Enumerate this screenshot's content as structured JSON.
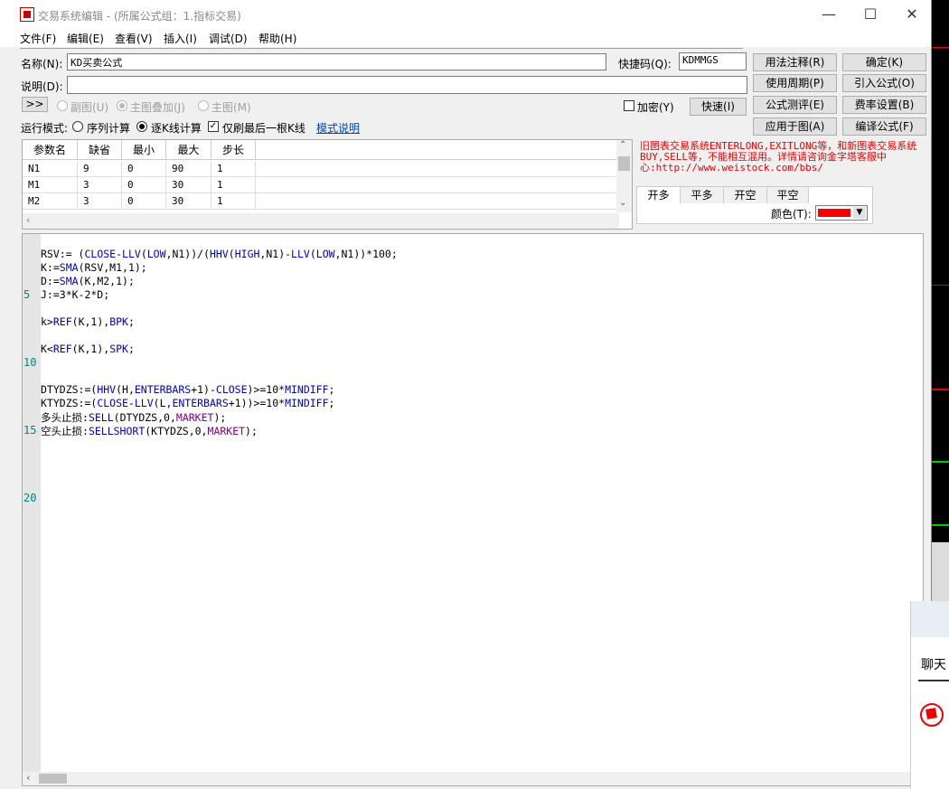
{
  "window": {
    "title": "交易系统编辑 - (所属公式组：1.指标交易)",
    "controls": {
      "minimize": "—",
      "maximize": "☐",
      "close": "✕"
    }
  },
  "menu": [
    "文件(F)",
    "编辑(E)",
    "查看(V)",
    "插入(I)",
    "调试(D)",
    "帮助(H)"
  ],
  "form": {
    "name_label": "名称(N):",
    "name_value": "KD买卖公式",
    "shortcut_label": "快捷码(Q):",
    "shortcut_value": "KDMMGS",
    "desc_label": "说明(D):",
    "desc_value": "",
    "expand_btn": ">>",
    "sub_chart": "副图(U)",
    "main_overlay": "主图叠加(J)",
    "main_chart": "主图(M)",
    "encrypt": "加密(Y)",
    "quick_btn": "快速(I)",
    "run_mode_label": "运行模式:",
    "seq_calc": "序列计算",
    "kline_calc": "逐K线计算",
    "refresh_last": "仅刷最后一根K线",
    "mode_link": "模式说明"
  },
  "buttons": {
    "usage": "用法注释(R)",
    "confirm": "确定(K)",
    "use_period": "使用周期(P)",
    "import": "引入公式(O)",
    "test": "公式测评(E)",
    "fee": "费率设置(B)",
    "apply": "应用于图(A)",
    "compile": "编译公式(F)"
  },
  "params": {
    "headers": [
      "参数名",
      "缺省",
      "最小",
      "最大",
      "步长"
    ],
    "rows": [
      [
        "N1",
        "9",
        "0",
        "90",
        "1"
      ],
      [
        "M1",
        "3",
        "0",
        "30",
        "1"
      ],
      [
        "M2",
        "3",
        "0",
        "30",
        "1"
      ]
    ]
  },
  "note": "旧图表交易系统ENTERLONG,EXITLONG等，和新图表交易系统BUY,SELL等，不能相互混用。详情请咨询金字塔客服中心:http://www.weistock.com/bbs/",
  "tabs": [
    "开多",
    "平多",
    "开空",
    "平空"
  ],
  "color_label": "颜色(T):",
  "color_value": "#ff0000",
  "line_numbers": [
    "5",
    "10",
    "15",
    "20"
  ],
  "code_lines": [
    "RSV:= (CLOSE-LLV(LOW,N1))/(HHV(HIGH,N1)-LLV(LOW,N1))*100;",
    "K:=SMA(RSV,M1,1);",
    "D:=SMA(K,M2,1);",
    "J:=3*K-2*D;",
    "",
    "k>REF(K,1),BPK;",
    "",
    "K<REF(K,1),SPK;",
    "",
    "",
    "DTYDZS:=(HHV(H,ENTERBARS+1)-CLOSE)>=10*MINDIFF;",
    "KTYDZS:=(CLOSE-LLV(L,ENTERBARS+1))>=10*MINDIFF;",
    "多头止损:SELL(DTYDZS,0,MARKET);",
    "空头止损:SELLSHORT(KTYDZS,0,MARKET);"
  ],
  "chat": {
    "label": "聊天"
  },
  "colors": {
    "accent_red": "#ff0000",
    "keyword": "#0000c0",
    "param_purple": "#800080"
  }
}
